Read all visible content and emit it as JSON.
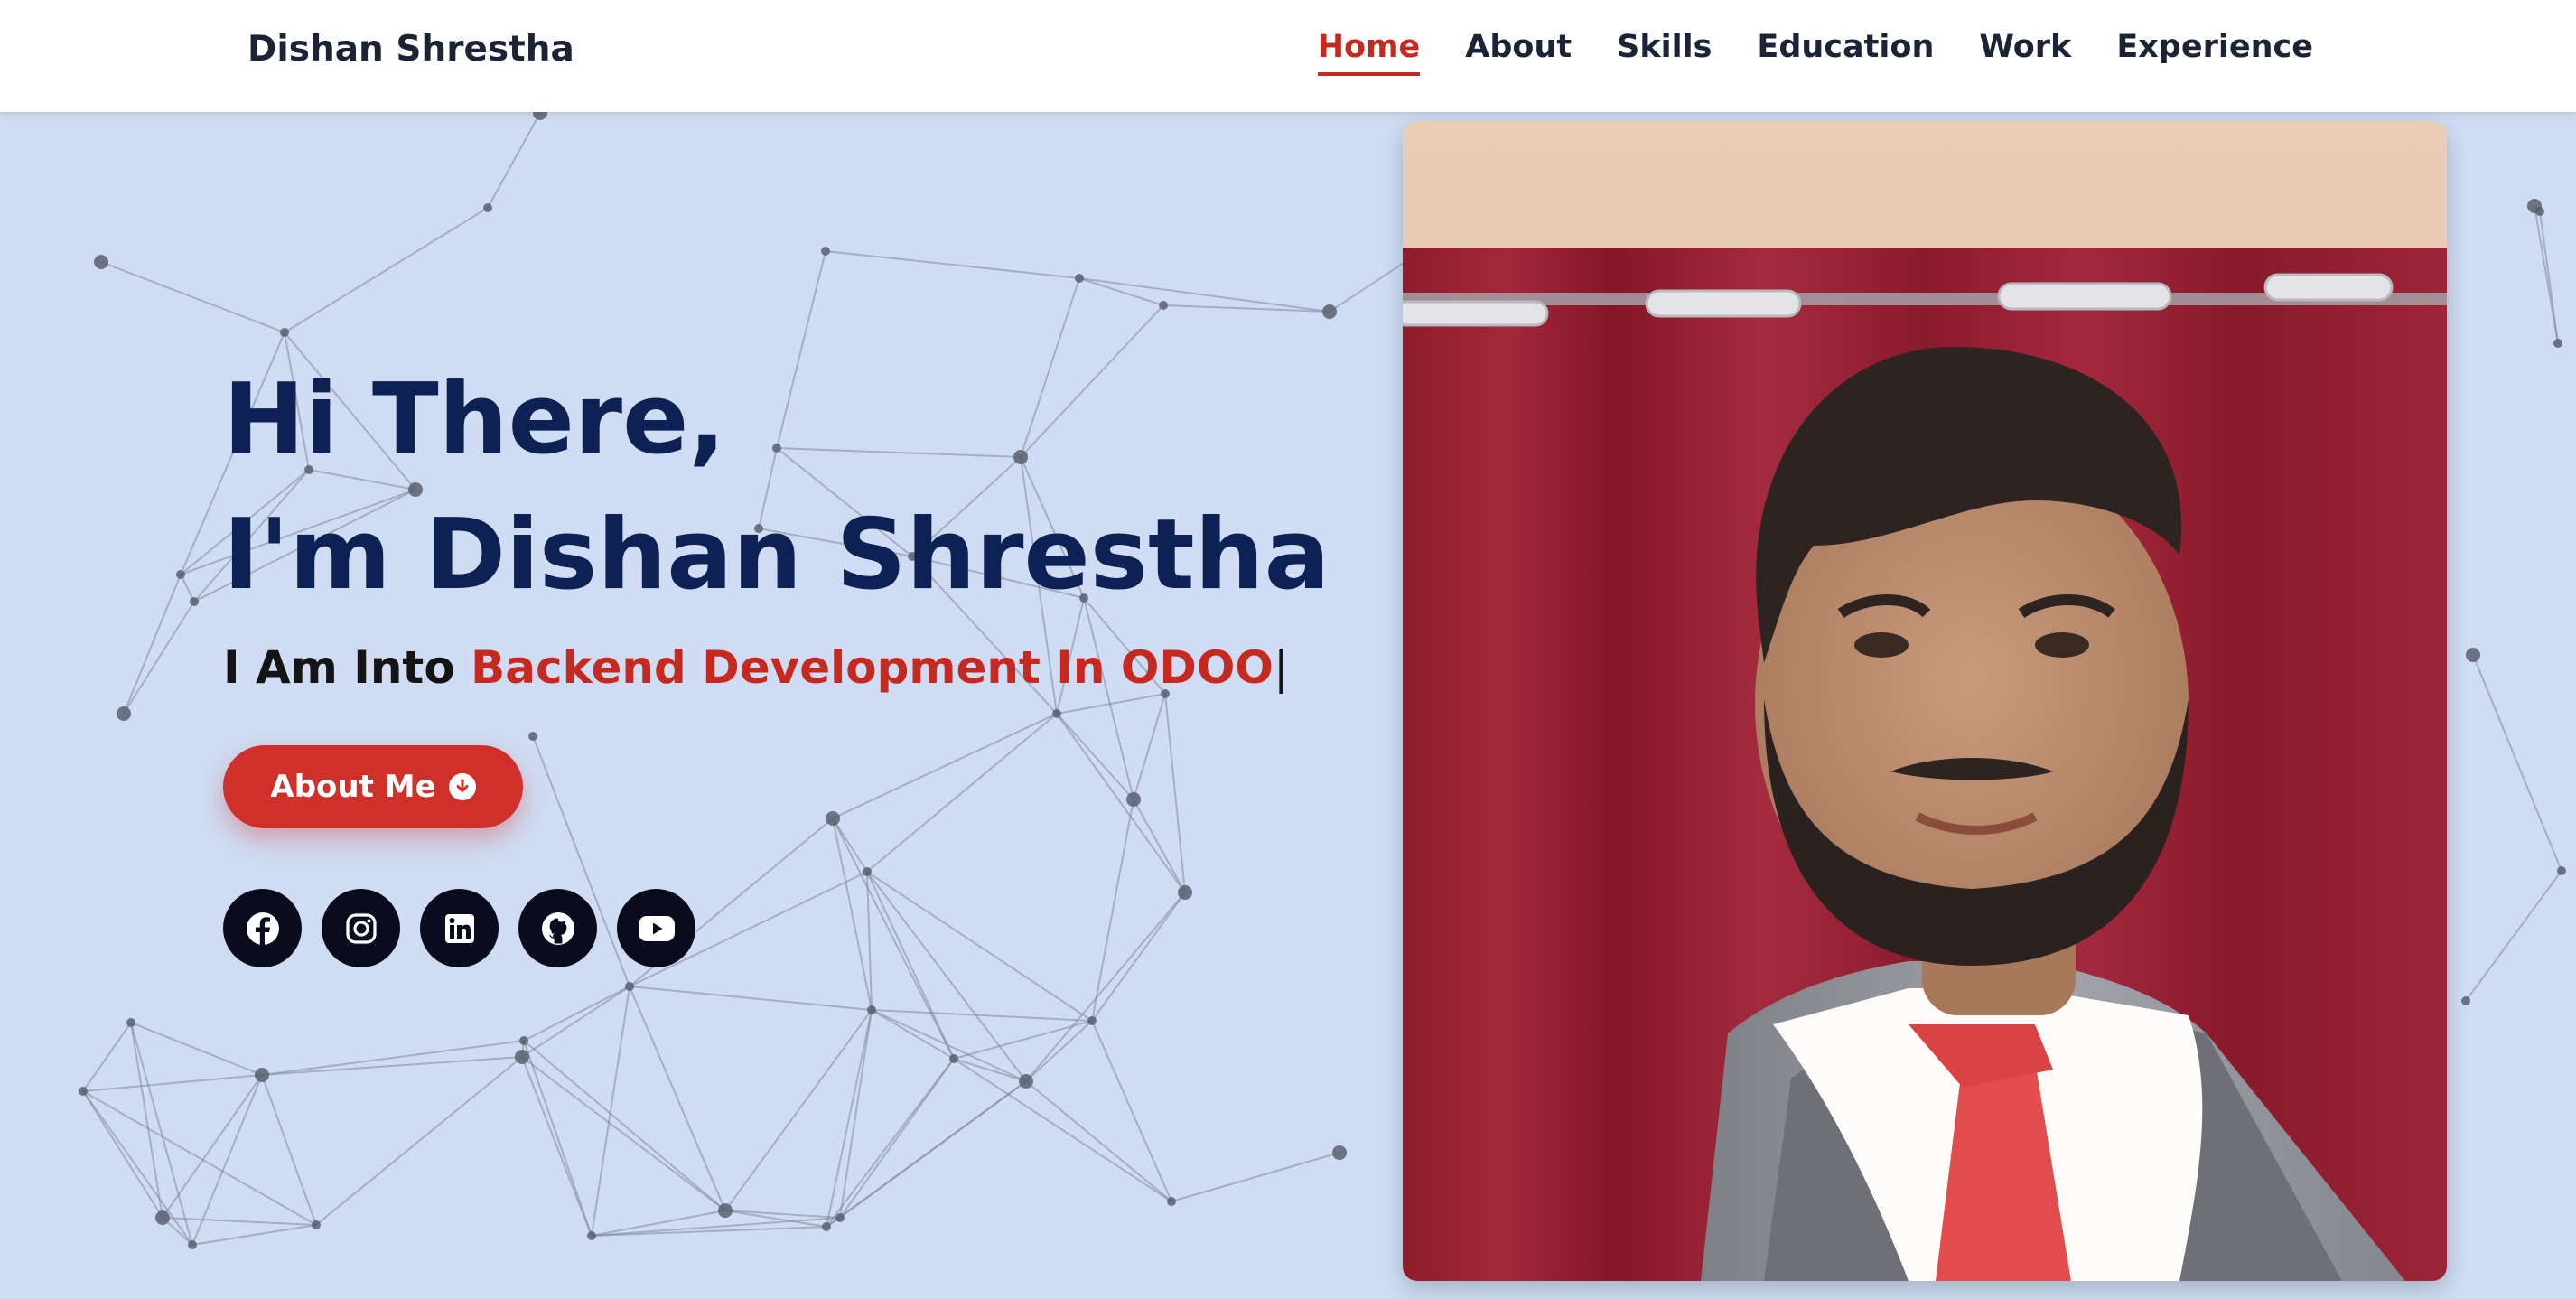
{
  "header": {
    "brand": "Dishan Shrestha",
    "nav": [
      {
        "label": "Home",
        "active": true
      },
      {
        "label": "About",
        "active": false
      },
      {
        "label": "Skills",
        "active": false
      },
      {
        "label": "Education",
        "active": false
      },
      {
        "label": "Work",
        "active": false
      },
      {
        "label": "Experience",
        "active": false
      }
    ]
  },
  "hero": {
    "greeting_line1": "Hi There,",
    "greeting_line2": "I'm Dishan Shrestha",
    "subtitle_prefix": "I Am Into",
    "subtitle_typed": "Backend Development In ODOO",
    "cursor": "|",
    "button_label": "About Me",
    "button_icon": "arrow-down-circle-icon"
  },
  "socials": [
    {
      "name": "facebook-icon"
    },
    {
      "name": "instagram-icon"
    },
    {
      "name": "linkedin-icon"
    },
    {
      "name": "github-icon"
    },
    {
      "name": "youtube-icon"
    }
  ],
  "colors": {
    "accent": "#c52a21",
    "heading": "#0d2155",
    "background": "#cfdcf3",
    "social_bg": "#0b0b1e"
  }
}
